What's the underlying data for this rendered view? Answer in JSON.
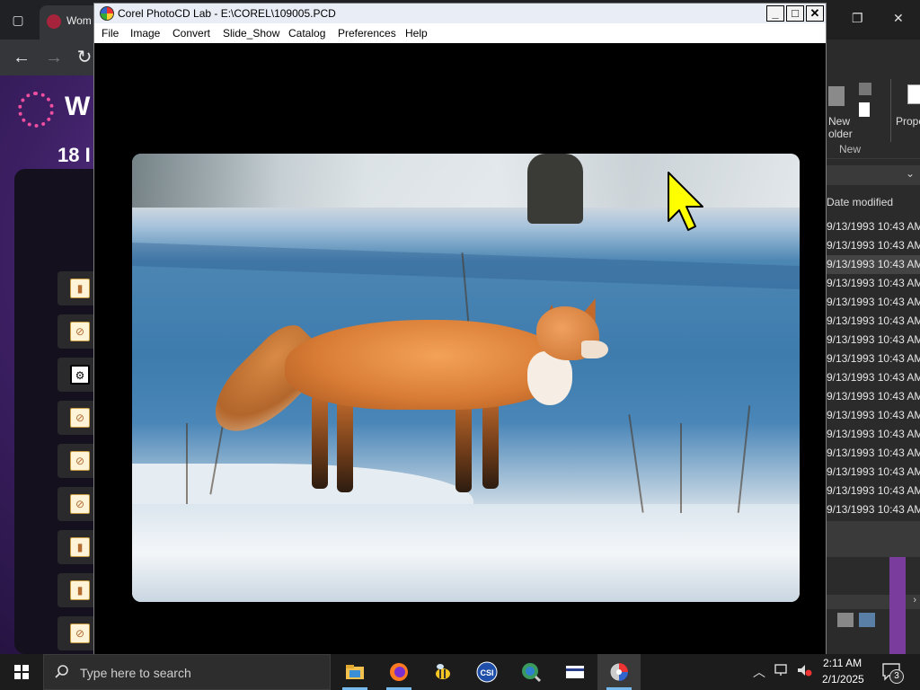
{
  "browser": {
    "tab_title": "Wom",
    "site_title": "W",
    "page_heading": "18 I"
  },
  "explorer": {
    "ribbon": {
      "new_folder_label": "New\nolder",
      "group_new": "New",
      "properties_label": "Prope"
    },
    "column_header": "Date modified",
    "file_dates": [
      "9/13/1993 10:43 AM",
      "9/13/1993 10:43 AM",
      "9/13/1993 10:43 AM",
      "9/13/1993 10:43 AM",
      "9/13/1993 10:43 AM",
      "9/13/1993 10:43 AM",
      "9/13/1993 10:43 AM",
      "9/13/1993 10:43 AM",
      "9/13/1993 10:43 AM",
      "9/13/1993 10:43 AM",
      "9/13/1993 10:43 AM",
      "9/13/1993 10:43 AM",
      "9/13/1993 10:43 AM",
      "9/13/1993 10:43 AM",
      "9/13/1993 10:43 AM",
      "9/13/1993 10:43 AM"
    ]
  },
  "photocd": {
    "title": "Corel PhotoCD Lab - E:\\COREL\\109005.PCD",
    "controls": {
      "minimize": "_",
      "maximize": "□",
      "close": "✕"
    },
    "menu": [
      "File",
      "Image",
      "Convert",
      "Slide_Show",
      "Catalog",
      "Preferences",
      "Help"
    ]
  },
  "taskbar": {
    "search_placeholder": "Type here to search",
    "time": "2:11 AM",
    "date": "2/1/2025",
    "notification_count": "3"
  },
  "icons": {
    "app": "photocd-icon",
    "cursor": "yellow-pointer-icon",
    "start": "windows-start-icon"
  },
  "colors": {
    "taskbar": "#1c1c1c",
    "titlebar": "#e9edf5",
    "cursor": "#ffff00",
    "accent_underline": "#76b9ed"
  }
}
